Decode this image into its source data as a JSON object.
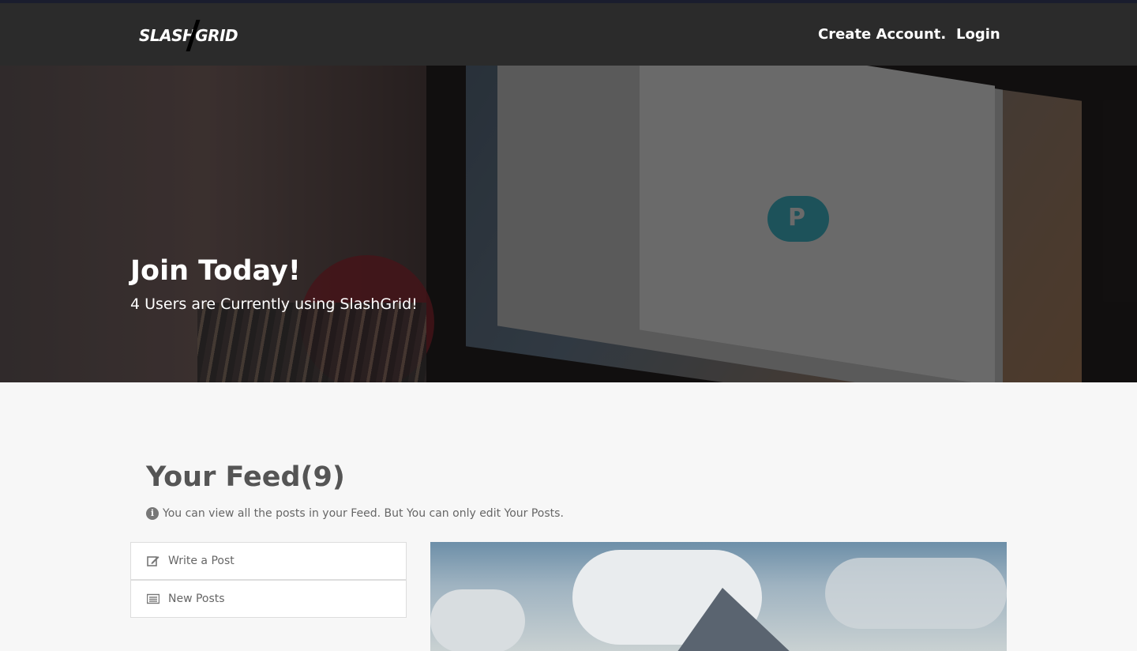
{
  "navbar": {
    "logo_text": "SLASHGRID",
    "links": [
      {
        "label": "Create Account."
      },
      {
        "label": "Login"
      }
    ]
  },
  "hero": {
    "title": "Join Today!",
    "subtitle": "4 Users are Currently using SlashGrid!"
  },
  "feed": {
    "title": "Your Feed(9)",
    "info_icon": "info-circle-icon",
    "info_text": "You can view all the posts in your Feed. But You can only edit Your Posts.",
    "menu": [
      {
        "label": "Write a Post",
        "icon": "edit-icon"
      },
      {
        "label": "New Posts",
        "icon": "list-icon"
      }
    ]
  },
  "colors": {
    "navbar_bg": "#2b2b2b",
    "page_bg": "#f7f7f7",
    "heading_text": "#555555"
  }
}
